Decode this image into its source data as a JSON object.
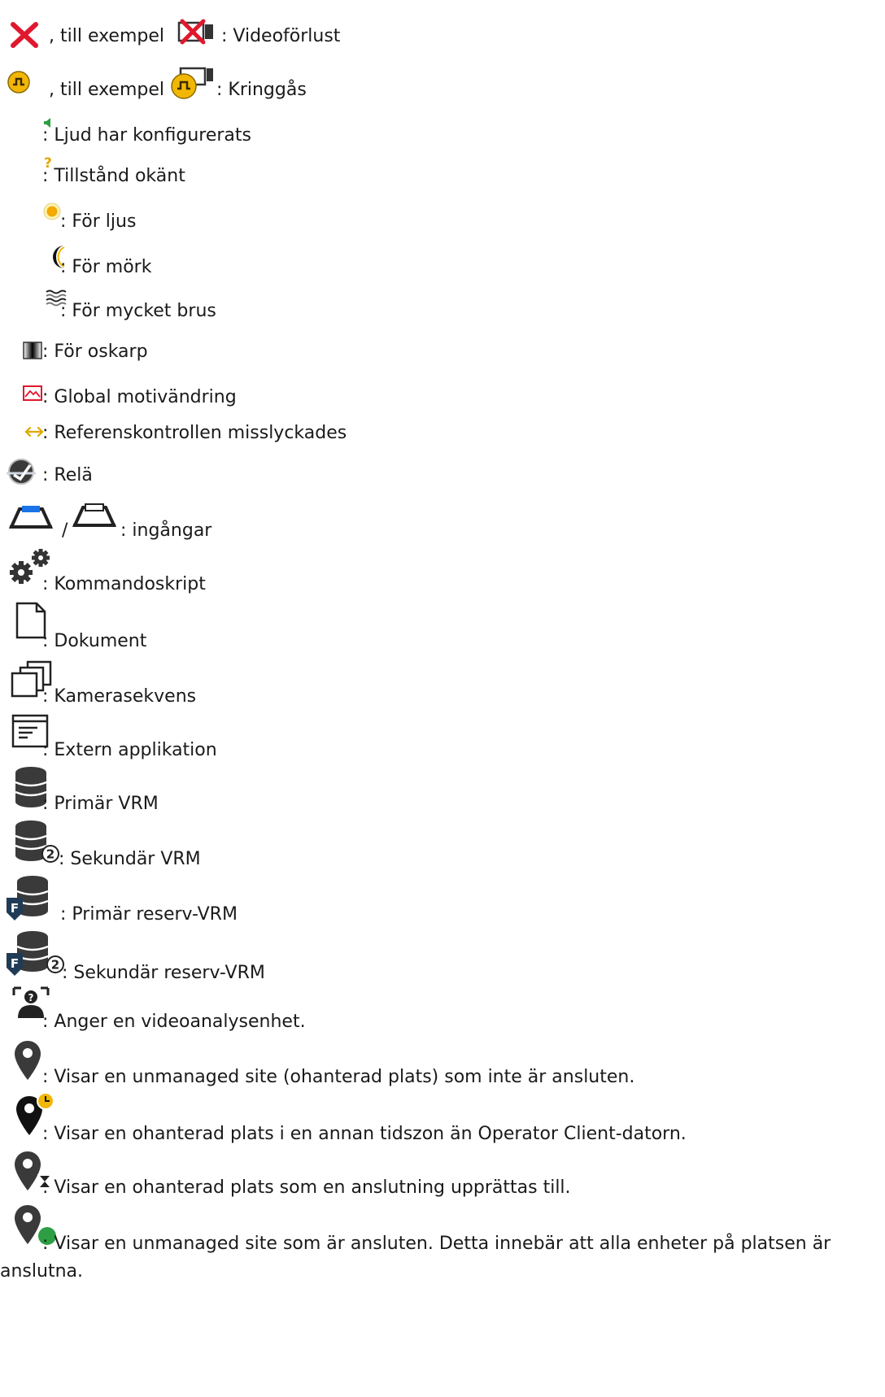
{
  "items": [
    {
      "key": "video_loss",
      "prefix": ", till exempel",
      "text": ": Videoförlust",
      "icons": [
        "red-x-icon",
        "camera-video-loss-icon"
      ]
    },
    {
      "key": "bypassed",
      "prefix": ", till exempel",
      "text": ": Kringgås",
      "icons": [
        "bypass-icon",
        "camera-bypassed-icon"
      ]
    },
    {
      "key": "audio",
      "text": ": Ljud har konfigurerats",
      "icons": [
        "speaker-icon"
      ]
    },
    {
      "key": "unknown",
      "text": ": Tillstånd okänt",
      "icons": [
        "question-icon"
      ]
    },
    {
      "key": "too_bright",
      "text": ": För ljus",
      "icons": [
        "sun-icon"
      ]
    },
    {
      "key": "too_dark",
      "text": ": För mörk",
      "icons": [
        "moon-icon"
      ]
    },
    {
      "key": "too_noisy",
      "text": ": För mycket brus",
      "icons": [
        "noise-icon"
      ]
    },
    {
      "key": "too_blurry",
      "text": ": För oskarp",
      "icons": [
        "blur-icon"
      ]
    },
    {
      "key": "global_scene_change",
      "text": ": Global motivändring",
      "icons": [
        "scene-change-icon"
      ]
    },
    {
      "key": "reference_check_failed",
      "text": ": Referenskontrollen misslyckades",
      "icons": [
        "reference-arrows-icon"
      ]
    },
    {
      "key": "relay",
      "text": ": Relä",
      "icons": [
        "relay-icon"
      ]
    },
    {
      "key": "inputs",
      "separator": "/",
      "text": ": ingångar",
      "icons": [
        "input-active-icon",
        "input-inactive-icon"
      ]
    },
    {
      "key": "command_script",
      "text": ": Kommandoskript",
      "icons": [
        "gears-icon"
      ]
    },
    {
      "key": "document",
      "text": ": Dokument",
      "icons": [
        "document-icon"
      ]
    },
    {
      "key": "camera_sequence",
      "text": ": Kamerasekvens",
      "icons": [
        "camera-sequence-icon"
      ]
    },
    {
      "key": "external_app",
      "text": ": Extern applikation",
      "icons": [
        "external-application-icon"
      ]
    },
    {
      "key": "primary_vrm",
      "text": ": Primär VRM",
      "icons": [
        "database-icon"
      ]
    },
    {
      "key": "secondary_vrm",
      "text": ": Sekundär VRM",
      "icons": [
        "database-secondary-icon"
      ]
    },
    {
      "key": "primary_failover_vrm",
      "text": ": Primär reserv-VRM",
      "icons": [
        "database-failover-icon"
      ]
    },
    {
      "key": "secondary_failover_vrm",
      "text": ": Sekundär reserv-VRM",
      "icons": [
        "database-failover-secondary-icon"
      ]
    },
    {
      "key": "video_analytics",
      "text": ": Anger en videoanalysenhet.",
      "icons": [
        "video-analytics-icon"
      ]
    },
    {
      "key": "site_unconnected",
      "text": ": Visar en unmanaged site (ohanterad plats) som inte är ansluten.",
      "icons": [
        "location-pin-icon"
      ]
    },
    {
      "key": "site_timezone",
      "text": ": Visar en ohanterad plats i en annan tidszon än Operator Client-datorn.",
      "icons": [
        "location-pin-clock-icon"
      ]
    },
    {
      "key": "site_connecting",
      "text": ": Visar en ohanterad plats som en anslutning upprättas till.",
      "icons": [
        "location-pin-hourglass-icon"
      ]
    },
    {
      "key": "site_connected",
      "text": ": Visar en unmanaged site som är ansluten. Detta innebär att alla enheter på platsen är anslutna.",
      "icons": [
        "location-pin-connected-icon"
      ]
    }
  ],
  "colors": {
    "text": "#1a1a1a",
    "red": "#e0182d",
    "yellow": "#f2b705",
    "green": "#2e9e44",
    "dark": "#3a3a3a"
  }
}
